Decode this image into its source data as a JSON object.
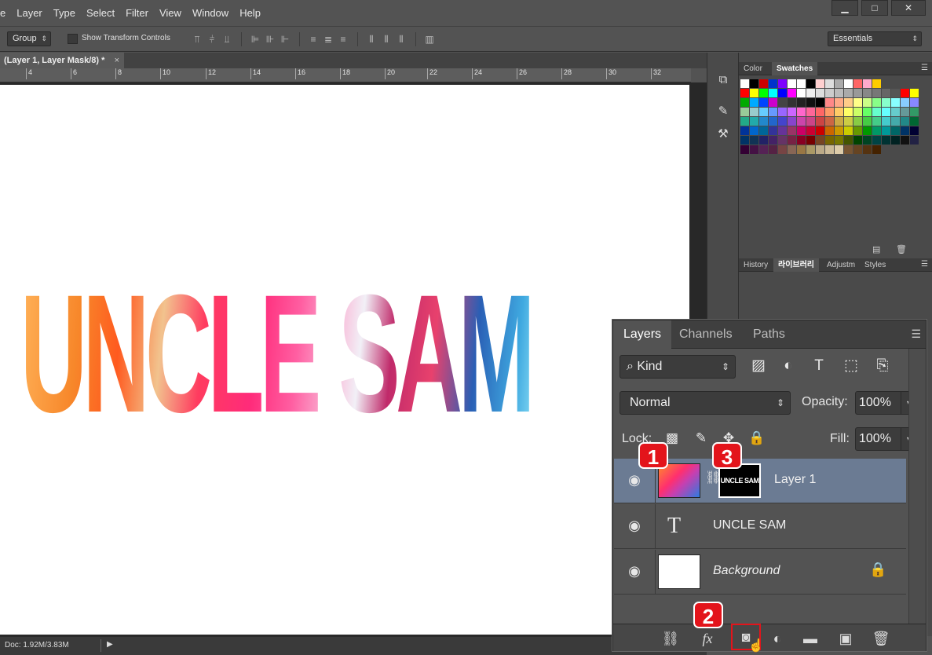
{
  "menu": {
    "items": [
      "e",
      "Layer",
      "Type",
      "Select",
      "Filter",
      "View",
      "Window",
      "Help"
    ],
    "window_buttons": [
      "▁",
      "□",
      "✕"
    ]
  },
  "options": {
    "auto_select": "Group",
    "show_transform_controls": "Show Transform Controls",
    "workspace": "Essentials"
  },
  "document": {
    "tab_title": "(Layer 1, Layer Mask/8) *",
    "tab_close": "×",
    "ruler_ticks": [
      "4",
      "6",
      "8",
      "10",
      "12",
      "14",
      "16",
      "18",
      "20",
      "22",
      "24",
      "26",
      "28",
      "30",
      "32"
    ],
    "canvas_text": "UNCLE SAM",
    "status": "Doc: 1.92M/3.83M"
  },
  "right_panel": {
    "top_tabs": [
      "Color",
      "Swatches"
    ],
    "bottom_tabs": [
      "History",
      "라이브러리",
      "Adjustm",
      "Styles"
    ]
  },
  "layers_panel": {
    "tabs": [
      "Layers",
      "Channels",
      "Paths"
    ],
    "filter_kind": "Kind",
    "blend_mode": "Normal",
    "opacity_label": "Opacity:",
    "opacity_value": "100%",
    "lock_label": "Lock:",
    "fill_label": "Fill:",
    "fill_value": "100%",
    "layers": [
      {
        "name": "Layer 1",
        "mask_text": "UNCLE SAM",
        "selected": true
      },
      {
        "name": "UNCLE SAM",
        "type_glyph": "T"
      },
      {
        "name": "Background",
        "locked": true
      }
    ],
    "footer_icons": [
      "link-icon",
      "fx-icon",
      "mask-icon",
      "adjustment-icon",
      "folder-icon",
      "new-layer-icon",
      "trash-icon"
    ],
    "fx_label": "fx",
    "callouts": [
      "1",
      "2",
      "3"
    ]
  },
  "colors": {
    "accent_badge": "#e3141b",
    "selected_row": "#6b7b93"
  }
}
